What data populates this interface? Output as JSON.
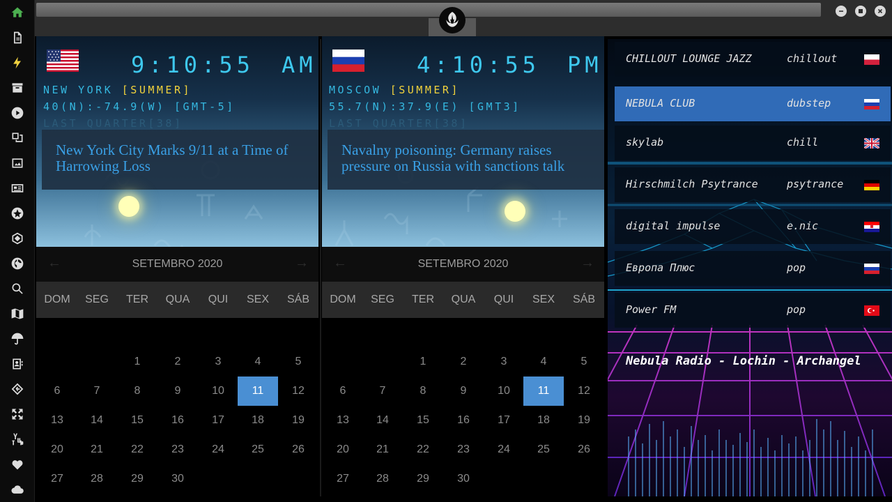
{
  "sidebar": {
    "items": [
      {
        "icon": "home-icon",
        "color": "#4caf50"
      },
      {
        "icon": "document-icon"
      },
      {
        "icon": "lightning-icon",
        "color": "#f0d040"
      },
      {
        "icon": "archive-icon"
      },
      {
        "icon": "play-circle-icon"
      },
      {
        "icon": "translate-icon"
      },
      {
        "icon": "image-icon"
      },
      {
        "icon": "newspaper-icon"
      },
      {
        "icon": "rebel-alliance-icon"
      },
      {
        "icon": "hexagon-network-icon"
      },
      {
        "icon": "globe-icon"
      },
      {
        "icon": "search-icon"
      },
      {
        "icon": "map-icon"
      },
      {
        "icon": "umbrella-icon"
      },
      {
        "icon": "contact-card-icon"
      },
      {
        "icon": "code-diamond-icon"
      },
      {
        "icon": "expand-arrows-icon"
      },
      {
        "icon": "youtube-icon"
      },
      {
        "icon": "heart-icon"
      },
      {
        "icon": "cloud-icon"
      }
    ]
  },
  "window": {
    "controls": [
      "minimize-icon",
      "maximize-icon",
      "close-icon"
    ],
    "logo": "rebel-alliance-icon"
  },
  "clocks": [
    {
      "flag": "usa-flag",
      "time": "9:10:55",
      "ampm": "AM",
      "city": "NEW YORK",
      "season": "[SUMMER]",
      "coords": "40(N):-74.9(W) [GMT-5]",
      "moon": "LAST QUARTER[38]",
      "headline": "New York City Marks 9/11 at a Time of Harrowing Loss"
    },
    {
      "flag": "russia-flag",
      "time": "4:10:55",
      "ampm": "PM",
      "city": "MOSCOW",
      "season": "[SUMMER]",
      "coords": "55.7(N):37.9(E) [GMT3]",
      "moon": "LAST QUARTER[38]",
      "headline": "Navalny poisoning: Germany raises pressure on Russia with sanctions talk"
    }
  ],
  "calendar": {
    "month": "SETEMBRO 2020",
    "weekdays": [
      "DOM",
      "SEG",
      "TER",
      "QUA",
      "QUI",
      "SEX",
      "SÁB"
    ],
    "weeks": [
      [
        "",
        "",
        "1",
        "2",
        "3",
        "4",
        "5"
      ],
      [
        "6",
        "7",
        "8",
        "9",
        "10",
        "11",
        "12"
      ],
      [
        "13",
        "14",
        "15",
        "16",
        "17",
        "18",
        "19"
      ],
      [
        "20",
        "21",
        "22",
        "23",
        "24",
        "25",
        "26"
      ],
      [
        "27",
        "28",
        "29",
        "30",
        "",
        "",
        ""
      ]
    ],
    "selected": "11"
  },
  "radio": {
    "stations": [
      {
        "name": "CHILLOUT LOUNGE JAZZ",
        "genre": "chillout",
        "flag": "poland-flag"
      },
      {
        "name": "NEBULA CLUB",
        "genre": "dubstep",
        "flag": "russia-flag",
        "active": true
      },
      {
        "name": "skylab",
        "genre": "chill",
        "flag": "uk-flag"
      },
      {
        "name": "Hirschmilch Psytrance",
        "genre": "psytrance",
        "flag": "germany-flag"
      },
      {
        "name": "digital impulse",
        "genre": "e.nic",
        "flag": "croatia-flag"
      },
      {
        "name": "Европа Плюс",
        "genre": "pop",
        "flag": "russia-flag"
      },
      {
        "name": "Power FM",
        "genre": "pop",
        "flag": "turkey-flag"
      }
    ],
    "now_playing": "Nebula Radio - Lochin - Archangel"
  },
  "colors": {
    "accent": "#4a8fd3",
    "clock": "#3ec8ee",
    "season": "#f1d23c",
    "headline": "#3aa0e6"
  }
}
